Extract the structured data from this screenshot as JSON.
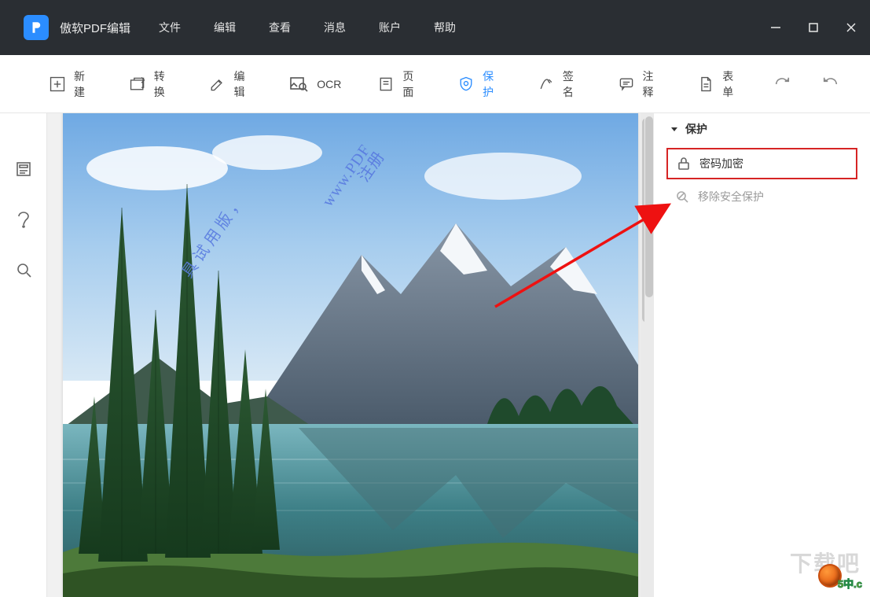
{
  "app": {
    "title": "傲软PDF编辑"
  },
  "menu": {
    "items": [
      "文件",
      "编辑",
      "查看",
      "消息",
      "账户",
      "帮助"
    ]
  },
  "toolbar": {
    "items": [
      {
        "id": "new",
        "label": "新建"
      },
      {
        "id": "convert",
        "label": "转换"
      },
      {
        "id": "edit",
        "label": "编辑"
      },
      {
        "id": "ocr",
        "label": "OCR"
      },
      {
        "id": "page",
        "label": "页面"
      },
      {
        "id": "protect",
        "label": "保护",
        "active": true
      },
      {
        "id": "sign",
        "label": "签名"
      },
      {
        "id": "annotate",
        "label": "注释"
      },
      {
        "id": "form",
        "label": "表单"
      }
    ]
  },
  "sidebar": {
    "icons": [
      "thumbnails",
      "bookmarks",
      "search"
    ]
  },
  "watermark": {
    "line1": "www.PDF",
    "line2": "注册",
    "line3": "具试用版，"
  },
  "panel": {
    "title": "保护",
    "items": [
      {
        "id": "encrypt",
        "label": "密码加密",
        "highlight": true
      },
      {
        "id": "remove",
        "label": "移除安全保护",
        "muted": true
      }
    ]
  },
  "dl_watermark": {
    "text": "下载吧",
    "num": "5中.c"
  }
}
